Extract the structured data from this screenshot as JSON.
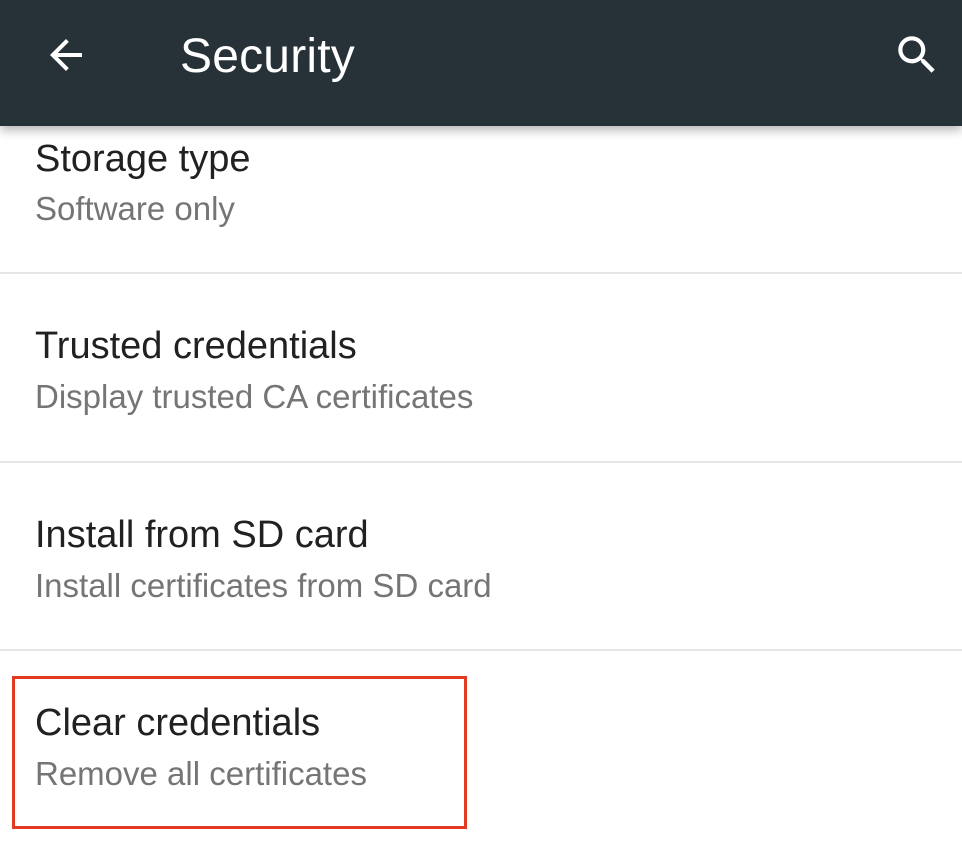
{
  "appbar": {
    "title": "Security",
    "background": "#263238",
    "back_icon": "arrow-back-icon",
    "search_icon": "search-icon"
  },
  "items": [
    {
      "title": "Storage type",
      "subtitle": "Software only"
    },
    {
      "title": "Trusted credentials",
      "subtitle": "Display trusted CA certificates"
    },
    {
      "title": "Install from SD card",
      "subtitle": "Install certificates from SD card"
    },
    {
      "title": "Clear credentials",
      "subtitle": "Remove all certificates"
    }
  ],
  "highlight": {
    "target": "Clear credentials",
    "color": "#e53a22"
  }
}
